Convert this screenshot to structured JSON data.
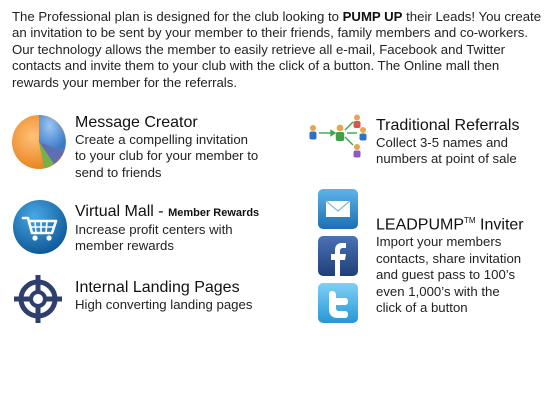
{
  "intro": {
    "part1": "The Professional plan is designed for the club looking to ",
    "emphasis": "PUMP UP",
    "part2": " their Leads! You create an invitation to be sent by your member to their friends, family members and co-workers. Our technology allows the member to easily retrieve all e-mail, Facebook and Twitter contacts and invite them to your club with the click of a button. The Online mall then rewards your member for the referrals."
  },
  "features": {
    "message_creator": {
      "title": "Message Creator",
      "desc_lines": [
        "Create a compelling invitation",
        "to your club for your member to",
        "send to friends"
      ],
      "icon": "pie-chart-icon"
    },
    "virtual_mall": {
      "title": "Virtual Mall - ",
      "subtitle": "Member Rewards",
      "desc_lines": [
        "Increase profit centers with",
        "member rewards"
      ],
      "icon": "shopping-cart-icon"
    },
    "landing_pages": {
      "title": "Internal Landing Pages",
      "desc_lines": [
        "High converting landing pages"
      ],
      "icon": "target-icon"
    },
    "traditional_referrals": {
      "title": "Traditional Referrals",
      "desc_lines": [
        "Collect 3-5 names and",
        "numbers at point of sale"
      ],
      "icon": "referral-network-icon"
    },
    "leadpump": {
      "title": "LEADPUMP",
      "tm": "TM",
      "title_rest": " Inviter",
      "desc_lines": [
        "Import your members",
        "contacts, share invitation",
        "and guest pass to 100’s",
        "even 1,000’s with the",
        "click of a button"
      ],
      "icons": [
        "email-icon",
        "facebook-icon",
        "twitter-icon"
      ]
    }
  },
  "colors": {
    "pie_orange": "#f39a2e",
    "pie_blue": "#4c8fd9",
    "cart_blue": "#1f77b4",
    "target_navy": "#2e3f6e",
    "mail_blue": "#2f86c9",
    "facebook_blue": "#2a4f8f",
    "twitter_blue": "#39a7e0"
  }
}
